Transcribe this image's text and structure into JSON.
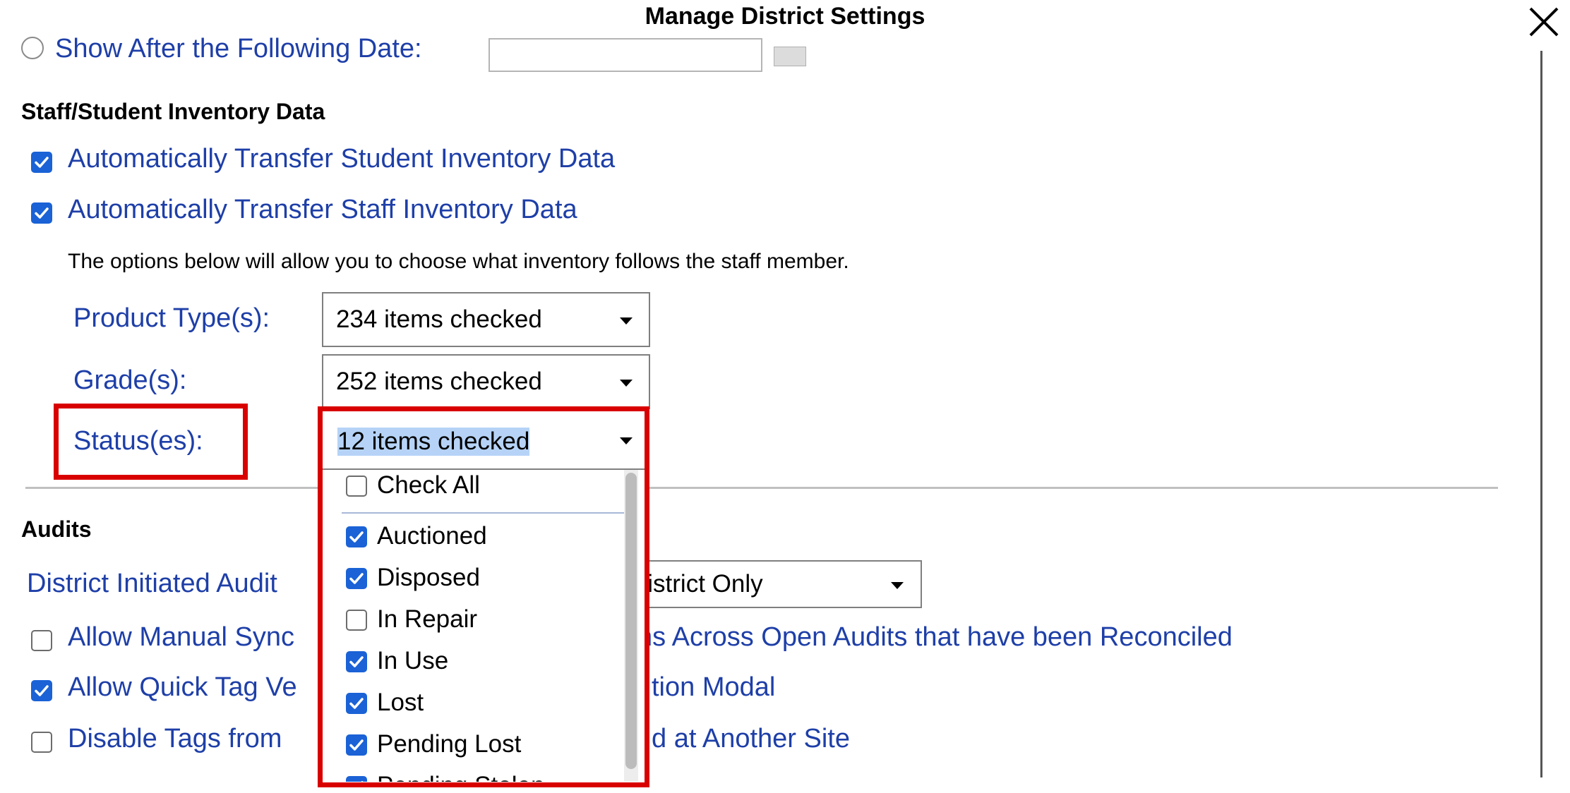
{
  "dialog": {
    "title": "Manage District Settings",
    "close_icon": "close-icon"
  },
  "top_partial": {
    "radio_label": "Show After the Following Date:",
    "date_value": ""
  },
  "staff_section": {
    "heading": "Staff/Student Inventory Data",
    "transfer_student": {
      "label": "Automatically Transfer Student Inventory Data",
      "checked": true
    },
    "transfer_staff": {
      "label": "Automatically Transfer Staff Inventory Data",
      "checked": true
    },
    "description": "The options below will allow you to choose what inventory follows the staff member.",
    "product_types": {
      "label": "Product Type(s):",
      "value": "234 items checked"
    },
    "grades": {
      "label": "Grade(s):",
      "value": "252 items checked"
    },
    "statuses": {
      "label": "Status(es):",
      "value": "12 items checked"
    }
  },
  "status_dropdown": {
    "check_all": {
      "label": "Check All",
      "checked": false
    },
    "options": [
      {
        "label": "Auctioned",
        "checked": true
      },
      {
        "label": "Disposed",
        "checked": true
      },
      {
        "label": "In Repair",
        "checked": false
      },
      {
        "label": "In Use",
        "checked": true
      },
      {
        "label": "Lost",
        "checked": true
      },
      {
        "label": "Pending Lost",
        "checked": true
      },
      {
        "label": "Pending Stolen",
        "checked": true
      }
    ]
  },
  "audits": {
    "heading": "Audits",
    "district_initiated": {
      "label": "District Initiated Audit",
      "value": "District Only"
    },
    "manual_sync": {
      "label": "Allow Manual Sync",
      "suffix": "ns Across Open Audits that have been Reconciled",
      "checked": false
    },
    "quick_tag": {
      "label": "Allow Quick Tag Ve",
      "suffix": "tion Modal",
      "checked": true
    },
    "disable_tags": {
      "label": "Disable Tags from",
      "suffix": "d at Another Site",
      "checked": false
    }
  },
  "colors": {
    "label_blue": "#1e3fa8",
    "highlight_red": "#d90000",
    "checkbox_blue": "#1a62d6",
    "selection": "#b6d3f7"
  }
}
